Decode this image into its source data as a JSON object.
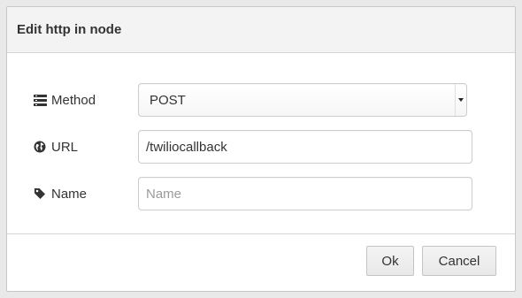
{
  "dialog": {
    "title": "Edit http in node"
  },
  "form": {
    "method": {
      "label": "Method",
      "icon": "list-icon",
      "value": "POST"
    },
    "url": {
      "label": "URL",
      "icon": "globe-icon",
      "value": "/twiliocallback"
    },
    "name": {
      "label": "Name",
      "icon": "tag-icon",
      "value": "",
      "placeholder": "Name"
    }
  },
  "footer": {
    "ok_label": "Ok",
    "cancel_label": "Cancel"
  }
}
